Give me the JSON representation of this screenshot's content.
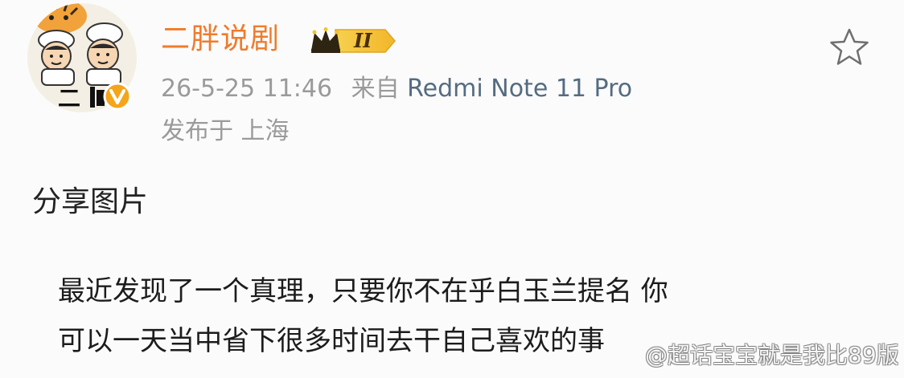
{
  "post": {
    "author_name": "二胖说剧",
    "badge_level": "II",
    "meta_line": {
      "date_time": "26-5-25 11:46",
      "from_label": "来自",
      "device": "Redmi Note 11 Pro"
    },
    "location_line": "发布于 上海",
    "title": "分享图片",
    "body": "最近发现了一个真理，只要你不在乎白玉兰提名 你\n可以一天当中省下很多时间去干自己喜欢的事"
  },
  "avatar": {
    "text_mark": "二"
  },
  "watermark": {
    "text": "@超话宝宝就是我比89版"
  },
  "icons": {
    "favorite": "star-outline-icon",
    "verified": "verified-v-icon",
    "crown": "crown-icon"
  },
  "colors": {
    "author_name": "#ef7b2c",
    "meta_gray": "#9a9a9a",
    "device_link": "#546b82",
    "verified_orange": "#f4a51a",
    "badge_gold": "#f2c230"
  }
}
